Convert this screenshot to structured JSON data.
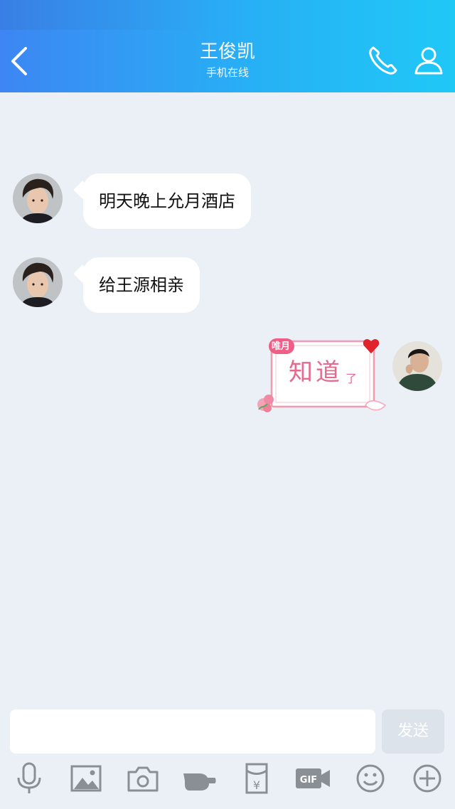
{
  "header": {
    "title": "王俊凯",
    "subtitle": "手机在线",
    "icons": [
      "back-arrow-icon",
      "phone-icon",
      "profile-icon"
    ]
  },
  "messages": [
    {
      "side": "left",
      "text": "明天晚上允月酒店"
    },
    {
      "side": "left",
      "text": "给王源相亲"
    },
    {
      "side": "right",
      "type": "sticker",
      "tag": "唯月",
      "sticker_text": "知道",
      "sticker_small": "了"
    }
  ],
  "composer": {
    "input_value": "",
    "send_label": "发送"
  },
  "toolbar": [
    "microphone-icon",
    "image-icon",
    "camera-icon",
    "poke-hand-icon",
    "red-packet-icon",
    "gif-icon",
    "emoji-icon",
    "plus-icon"
  ],
  "colors": {
    "header_start": "#3d86f3",
    "header_end": "#20c8f6",
    "background": "#ebf0f6"
  }
}
